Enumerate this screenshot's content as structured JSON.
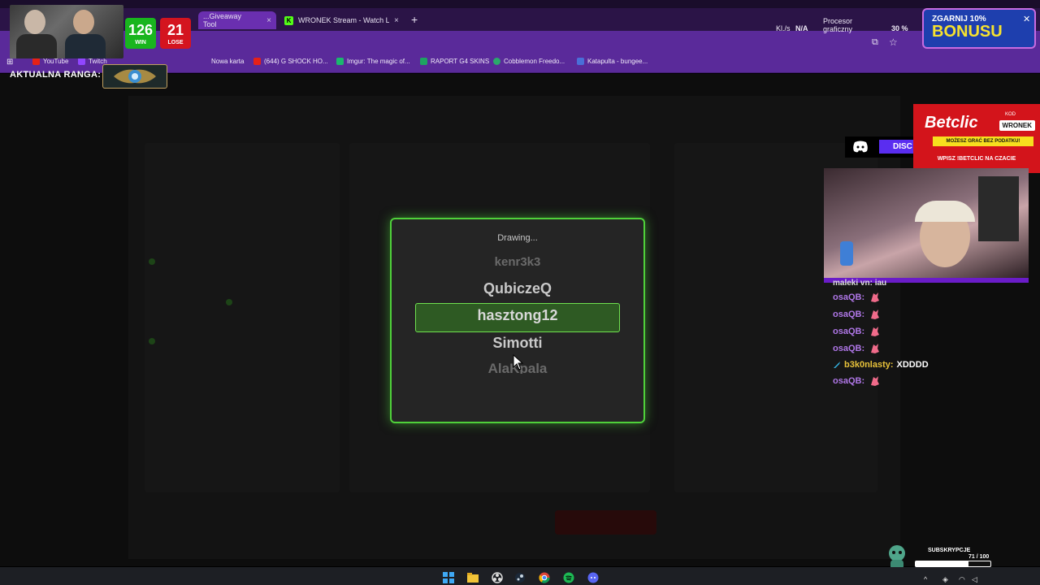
{
  "browser": {
    "tabs": [
      {
        "label": "...Giveaway Tool",
        "active": true
      },
      {
        "label": "WRONEK Stream - Watch Live o",
        "active": false
      }
    ],
    "tab_close": "×",
    "new_tab": "+",
    "performance": {
      "kl_label": "Kl./s",
      "kl_value": "N/A",
      "gpu_label_1": "Procesor",
      "gpu_label_2": "graficzny",
      "gpu_value": "30 %"
    },
    "bookmarks": [
      {
        "label": "YouTube",
        "color": "#e62117"
      },
      {
        "label": "Twitch",
        "color": "#9146ff"
      },
      {
        "label": "...",
        "color": "#444444"
      },
      {
        "label": "Nowa karta",
        "color": "#ffffff"
      },
      {
        "label": "(644) G SHOCK HO...",
        "color": "#e62117"
      },
      {
        "label": "Imgur: The magic of...",
        "color": "#1bb76e"
      },
      {
        "label": "RAPORT G4 SKINS",
        "color": "#1ea362"
      },
      {
        "label": "Cobblemon Freedo...",
        "color": "#2aa86b"
      },
      {
        "label": "Katapulta - bungee...",
        "color": "#4a6fd8"
      }
    ]
  },
  "modal": {
    "title": "Drawing...",
    "names": [
      "kenr3k3",
      "QubiczeQ",
      "hasztong12",
      "Simotti",
      "AlaKpala"
    ],
    "highlight_color": "#4fd13a"
  },
  "overlay": {
    "wins": "126",
    "wins_label": "WIN",
    "losses": "21",
    "losses_label": "LOSE",
    "rank_label": "AKTUALNA RANGA:",
    "bonus_top": "ZGARNIJ 10%",
    "bonus_main": "BONUSU",
    "betclic_logo": "Betclic",
    "betclic_kod": "KOD",
    "betclic_code": "WRONEK",
    "betclic_strip": "MOŻESZ GRAĆ BEZ PODATKU!",
    "betclic_promo": "WPISZ !BETCLIC NA CZACIE",
    "discord": "DISC",
    "subs_label": "SUBSKRYPCJE",
    "subs_count": "71 / 100",
    "subs_progress": 0.71
  },
  "chat": {
    "cut_line": "maleki vn: jau",
    "messages": [
      {
        "user": "osaQB:",
        "text": ""
      },
      {
        "user": "osaQB:",
        "text": ""
      },
      {
        "user": "osaQB:",
        "text": ""
      },
      {
        "user": "osaQB:",
        "text": ""
      },
      {
        "user": "b3k0nlasty:",
        "text": "XDDDD"
      },
      {
        "user": "osaQB:",
        "text": ""
      }
    ]
  }
}
